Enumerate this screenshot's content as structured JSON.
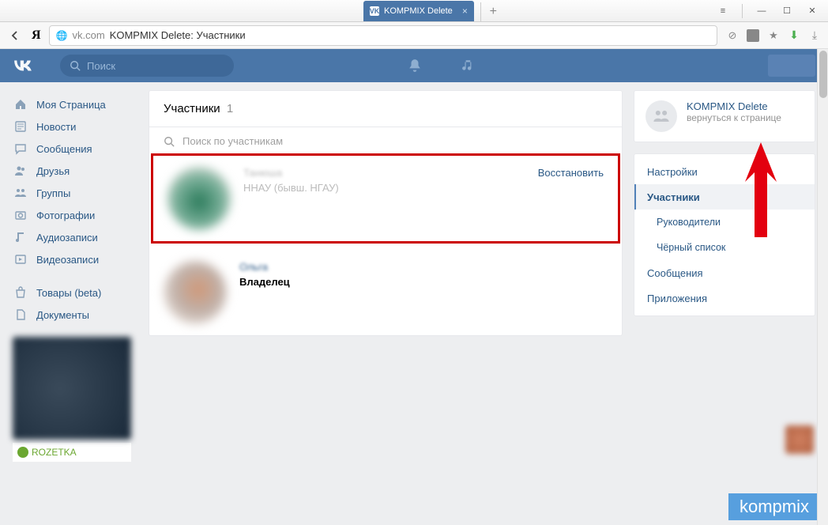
{
  "browser": {
    "tab_title": "KOMPMIX Delete",
    "new_tab": "+",
    "url_domain": "vk.com",
    "url_title": "KOMPMIX Delete: Участники"
  },
  "vk_header": {
    "search_placeholder": "Поиск"
  },
  "sidebar": {
    "items": [
      {
        "label": "Моя Страница",
        "icon": "home"
      },
      {
        "label": "Новости",
        "icon": "news"
      },
      {
        "label": "Сообщения",
        "icon": "chat"
      },
      {
        "label": "Друзья",
        "icon": "friends"
      },
      {
        "label": "Группы",
        "icon": "groups"
      },
      {
        "label": "Фотографии",
        "icon": "photo"
      },
      {
        "label": "Аудиозаписи",
        "icon": "audio"
      },
      {
        "label": "Видеозаписи",
        "icon": "video"
      }
    ],
    "items2": [
      {
        "label": "Товары (beta)",
        "icon": "shop"
      },
      {
        "label": "Документы",
        "icon": "docs"
      }
    ],
    "ad_label": "ROZETKA"
  },
  "content": {
    "title": "Участники",
    "count": "1",
    "search_placeholder": "Поиск по участникам",
    "members": [
      {
        "name": "Танюша",
        "sub": "ННАУ (бывш. НГАУ)",
        "action": "Восстановить",
        "deleted": true
      },
      {
        "name": "Ольга",
        "role": "Владелец"
      }
    ]
  },
  "rightcol": {
    "group_name": "KOMPMIX Delete",
    "group_sub": "вернуться к странице",
    "menu": [
      {
        "label": "Настройки"
      },
      {
        "label": "Участники",
        "active": true
      },
      {
        "label": "Руководители",
        "sub": true
      },
      {
        "label": "Чёрный список",
        "sub": true
      },
      {
        "label": "Сообщения"
      },
      {
        "label": "Приложения"
      }
    ]
  },
  "watermark": "kompmix"
}
